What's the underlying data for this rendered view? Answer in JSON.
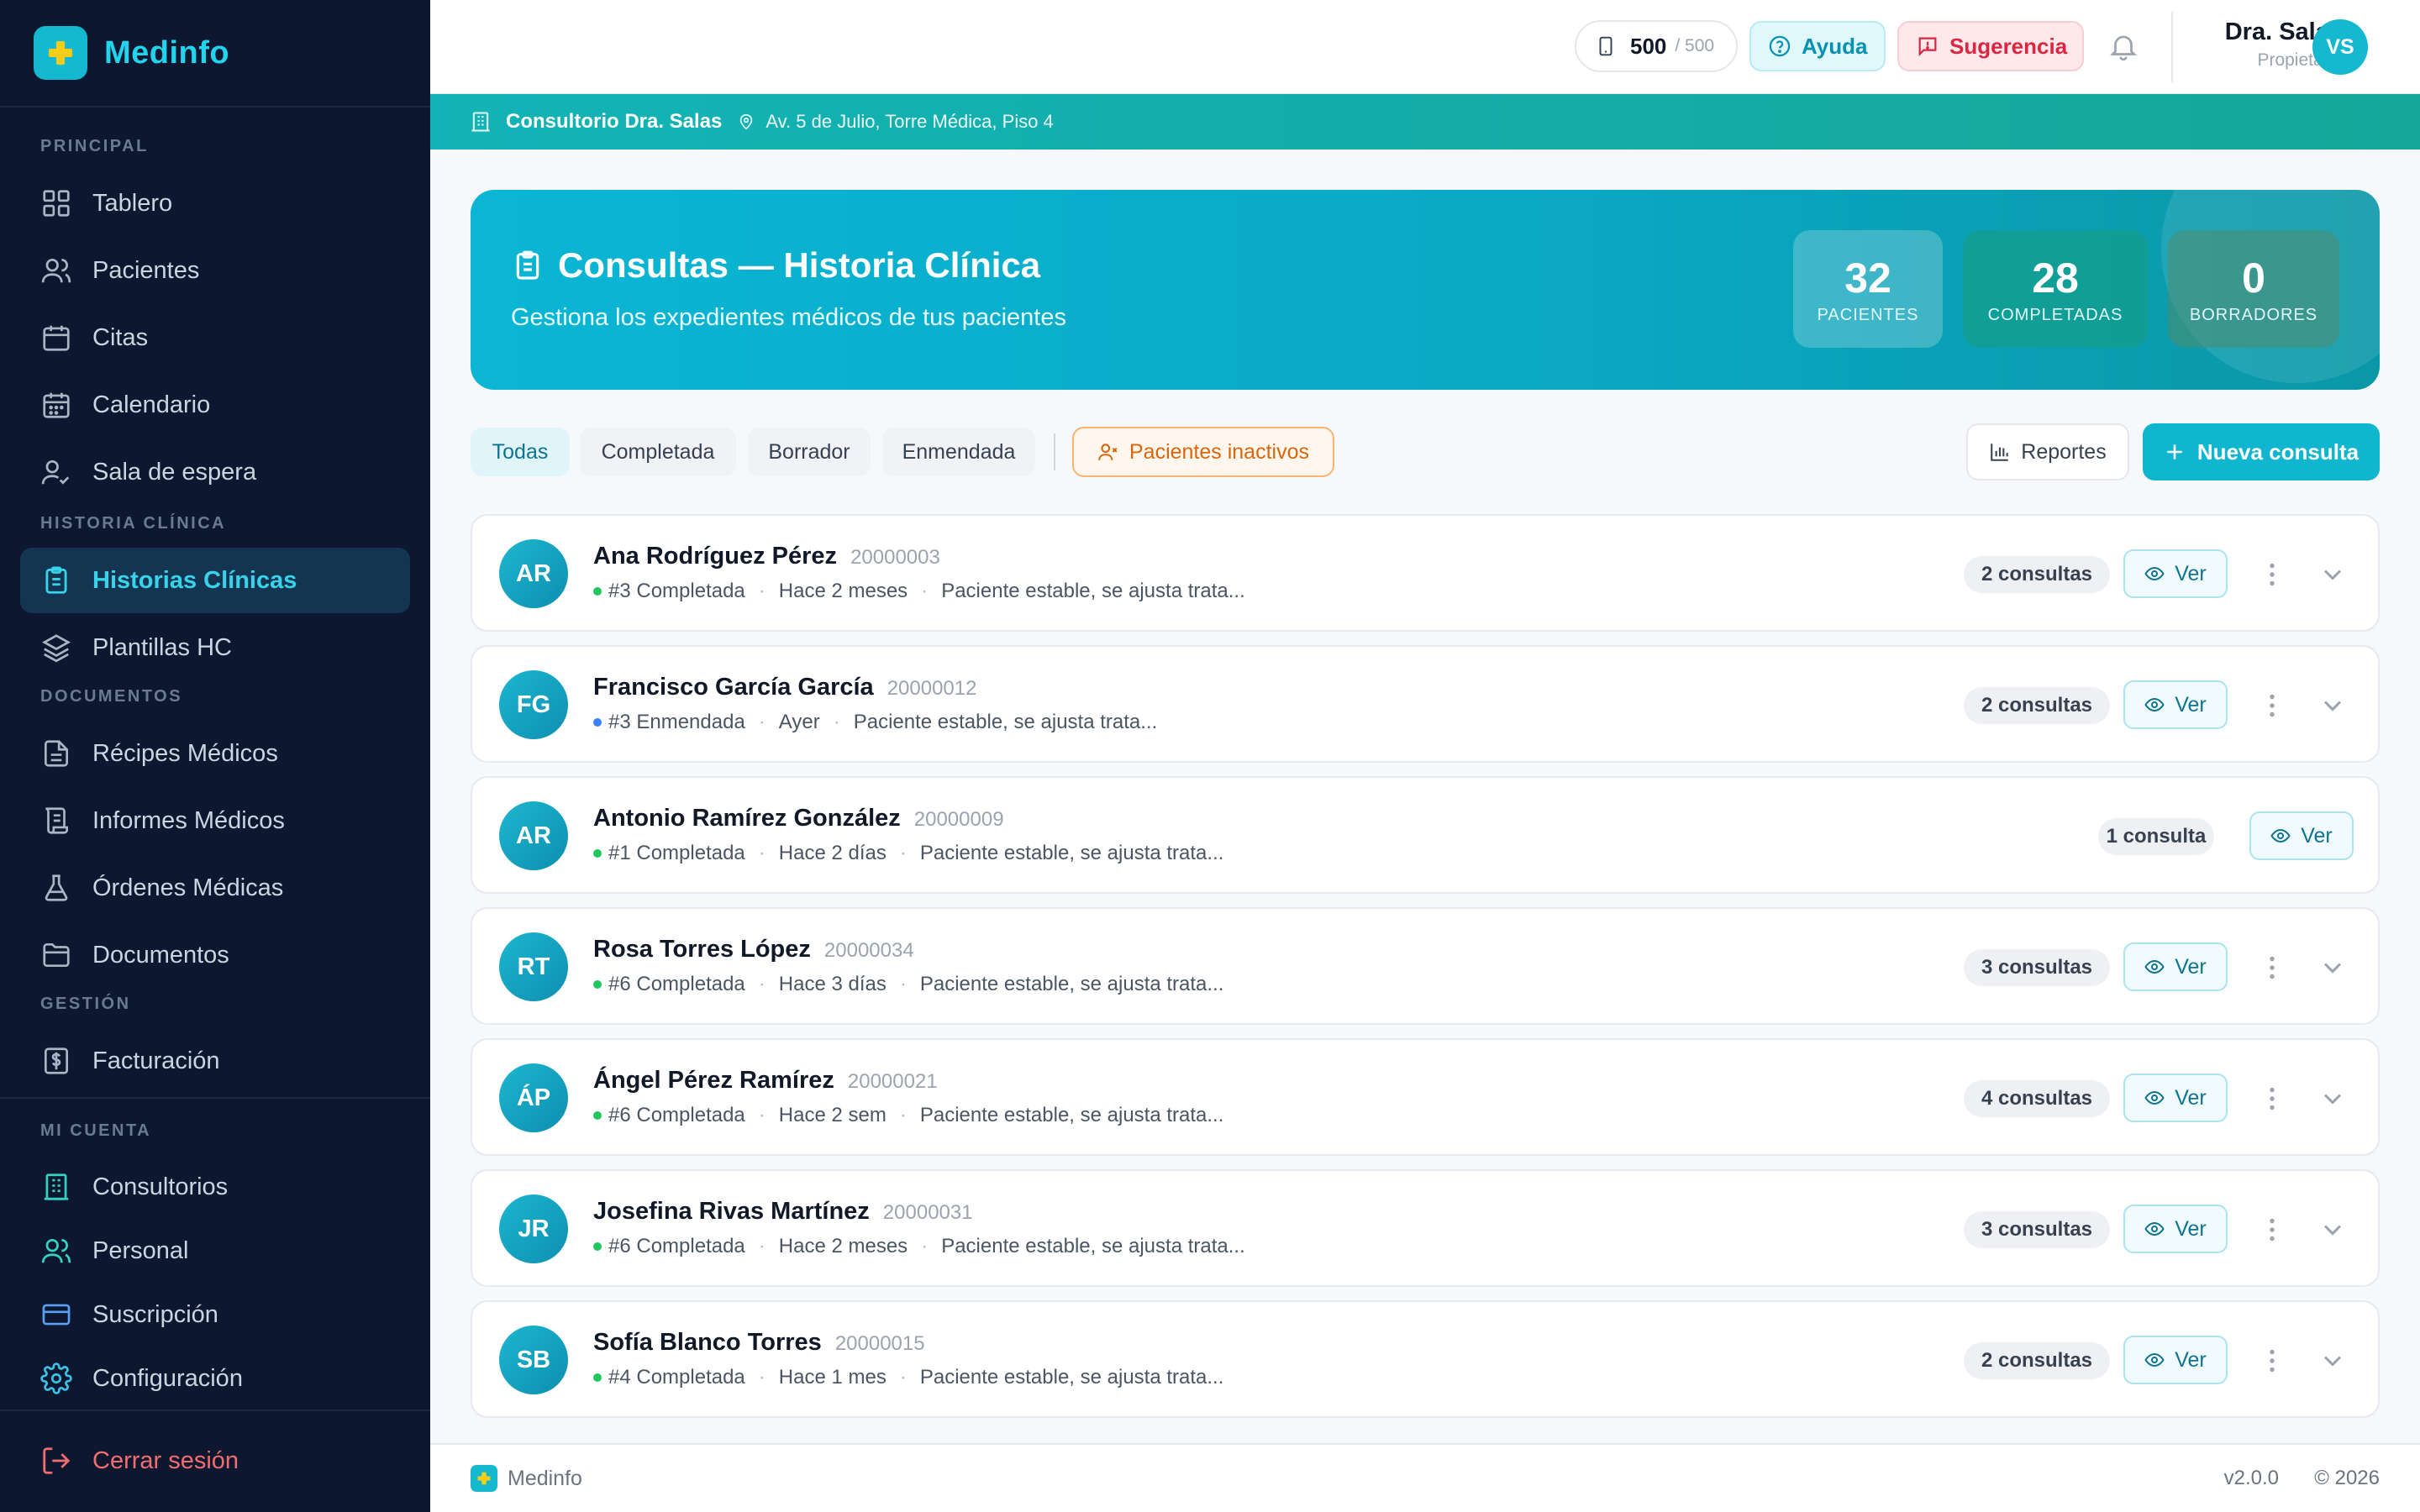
{
  "brand": {
    "name": "Medinfo"
  },
  "sidebar": {
    "sections": {
      "principal": "PRINCIPAL",
      "historia": "HISTORIA CLÍNICA",
      "documentos": "DOCUMENTOS",
      "gestion": "GESTIÓN",
      "cuenta": "MI CUENTA"
    },
    "items": [
      {
        "label": "Tablero",
        "icon": "grid-icon"
      },
      {
        "label": "Pacientes",
        "icon": "users-icon"
      },
      {
        "label": "Citas",
        "icon": "calendar-icon"
      },
      {
        "label": "Calendario",
        "icon": "calendar-grid-icon"
      },
      {
        "label": "Sala de espera",
        "icon": "user-check-icon"
      },
      {
        "label": "Historias Clínicas",
        "icon": "clipboard-icon",
        "active": true
      },
      {
        "label": "Plantillas HC",
        "icon": "layers-icon"
      },
      {
        "label": "Récipes Médicos",
        "icon": "file-text-icon"
      },
      {
        "label": "Informes Médicos",
        "icon": "scroll-icon"
      },
      {
        "label": "Órdenes Médicas",
        "icon": "flask-icon"
      },
      {
        "label": "Documentos",
        "icon": "folder-icon"
      },
      {
        "label": "Facturación",
        "icon": "dollar-icon"
      },
      {
        "label": "Consultorios",
        "icon": "building-icon"
      },
      {
        "label": "Personal",
        "icon": "team-icon"
      },
      {
        "label": "Suscripción",
        "icon": "credit-card-icon"
      },
      {
        "label": "Configuración",
        "icon": "gear-icon"
      }
    ],
    "logout": "Cerrar sesión"
  },
  "topbar": {
    "credits": {
      "count": "500",
      "total": "/ 500"
    },
    "help": "Ayuda",
    "suggest": "Sugerencia",
    "user": {
      "name": "Dra. Salas",
      "role": "Propietario",
      "initials": "VS"
    }
  },
  "clinic": {
    "name": "Consultorio Dra. Salas",
    "address": "Av. 5 de Julio, Torre Médica, Piso 4"
  },
  "hero": {
    "title": "Consultas — Historia Clínica",
    "subtitle": "Gestiona los expedientes médicos de tus pacientes",
    "stats": [
      {
        "value": "32",
        "label": "PACIENTES"
      },
      {
        "value": "28",
        "label": "COMPLETADAS"
      },
      {
        "value": "0",
        "label": "BORRADORES"
      }
    ]
  },
  "filters": {
    "all": "Todas",
    "completed": "Completada",
    "draft": "Borrador",
    "amended": "Enmendada",
    "inactive": "Pacientes inactivos"
  },
  "actions": {
    "reports": "Reportes",
    "new": "Nueva consulta"
  },
  "colors": {
    "accent": "#10b5cf",
    "status_completed": "#22c55e",
    "status_amended": "#3b82f6"
  },
  "patients": [
    {
      "initials": "AR",
      "name": "Ana Rodríguez Pérez",
      "id": "20000003",
      "status": "#3 Completada",
      "kind": "completed",
      "when": "Hace 2 meses",
      "note": "Paciente estable, se ajusta trata...",
      "count": "2 consultas",
      "ver": "Ver"
    },
    {
      "initials": "FG",
      "name": "Francisco García García",
      "id": "20000012",
      "status": "#3 Enmendada",
      "kind": "amended",
      "when": "Ayer",
      "note": "Paciente estable, se ajusta trata...",
      "count": "2 consultas",
      "ver": "Ver"
    },
    {
      "initials": "AR",
      "name": "Antonio Ramírez González",
      "id": "20000009",
      "status": "#1 Completada",
      "kind": "completed",
      "when": "Hace 2 días",
      "note": "Paciente estable, se ajusta trata...",
      "count": "1 consulta",
      "ver": "Ver"
    },
    {
      "initials": "RT",
      "name": "Rosa Torres López",
      "id": "20000034",
      "status": "#6 Completada",
      "kind": "completed",
      "when": "Hace 3 días",
      "note": "Paciente estable, se ajusta trata...",
      "count": "3 consultas",
      "ver": "Ver"
    },
    {
      "initials": "ÁP",
      "name": "Ángel Pérez Ramírez",
      "id": "20000021",
      "status": "#6 Completada",
      "kind": "completed",
      "when": "Hace 2 sem",
      "note": "Paciente estable, se ajusta trata...",
      "count": "4 consultas",
      "ver": "Ver"
    },
    {
      "initials": "JR",
      "name": "Josefina Rivas Martínez",
      "id": "20000031",
      "status": "#6 Completada",
      "kind": "completed",
      "when": "Hace 2 meses",
      "note": "Paciente estable, se ajusta trata...",
      "count": "3 consultas",
      "ver": "Ver"
    },
    {
      "initials": "SB",
      "name": "Sofía Blanco Torres",
      "id": "20000015",
      "status": "#4 Completada",
      "kind": "completed",
      "when": "Hace 1 mes",
      "note": "Paciente estable, se ajusta trata...",
      "count": "2 consultas",
      "ver": "Ver"
    }
  ],
  "footer": {
    "brand": "Medinfo",
    "version": "v2.0.0",
    "copyright": "© 2026"
  }
}
